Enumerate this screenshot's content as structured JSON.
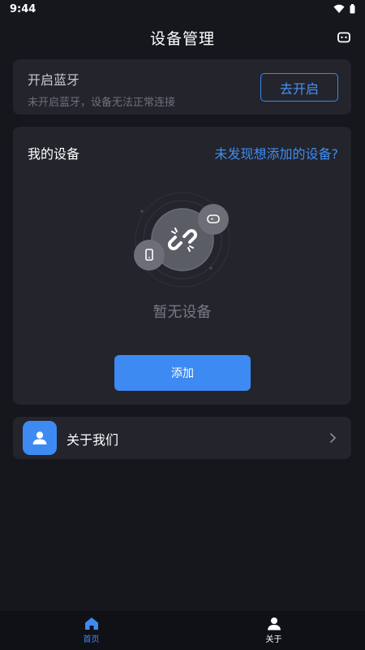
{
  "status_bar": {
    "time": "9:44",
    "icons": [
      "wifi-icon",
      "battery-icon"
    ]
  },
  "header": {
    "title": "设备管理",
    "action_icon": "bot-icon"
  },
  "bluetooth": {
    "title": "开启蓝牙",
    "subtitle": "未开启蓝牙，设备无法正常连接",
    "button_label": "去开启"
  },
  "devices": {
    "title": "我的设备",
    "help_link": "未发现想添加的设备?",
    "empty_text": "暂无设备",
    "add_label": "添加",
    "illustration_icons": [
      "broken-link-icon",
      "gamepad-icon",
      "phone-icon"
    ]
  },
  "about": {
    "label": "关于我们",
    "icon": "person-icon"
  },
  "tabbar": {
    "tabs": [
      {
        "label": "首页",
        "icon": "home-icon",
        "active": true
      },
      {
        "label": "关于",
        "icon": "person-icon",
        "active": false
      }
    ]
  },
  "colors": {
    "accent": "#3d8af2",
    "background": "#16171d",
    "card": "#23242c"
  }
}
